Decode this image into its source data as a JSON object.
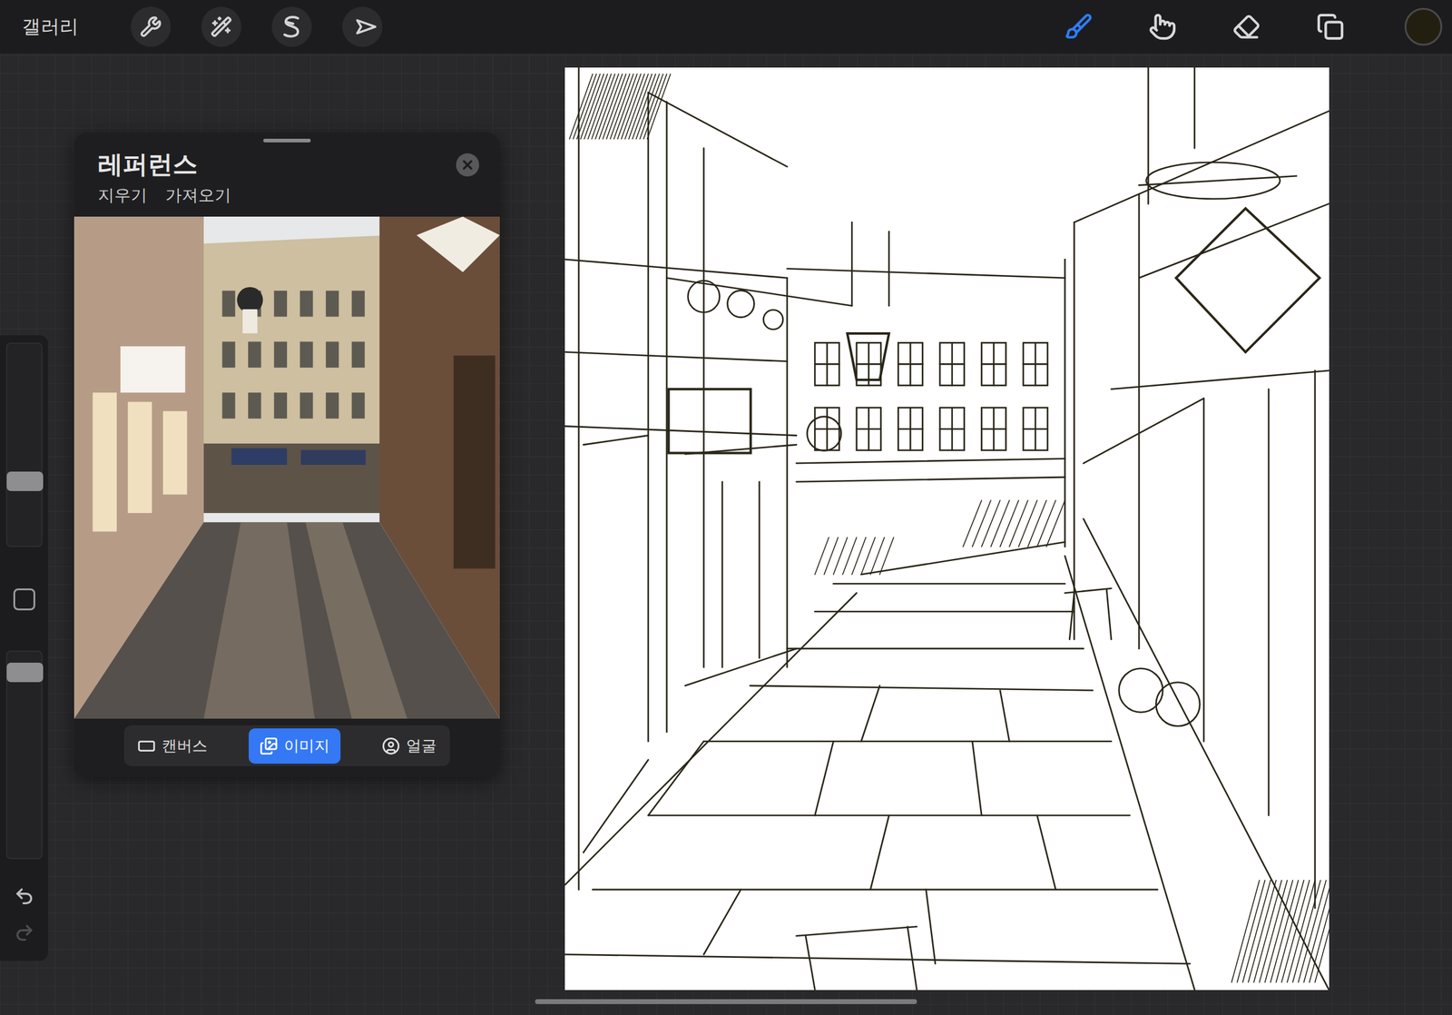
{
  "topbar": {
    "gallery": "갤러리",
    "tools_left": [
      {
        "kind": "wrench"
      },
      {
        "kind": "adjust"
      },
      {
        "kind": "selection"
      },
      {
        "kind": "transform"
      }
    ],
    "tools_right": [
      {
        "kind": "brush",
        "selected": true
      },
      {
        "kind": "smudge",
        "selected": false
      },
      {
        "kind": "eraser",
        "selected": false
      },
      {
        "kind": "layers",
        "selected": false
      }
    ],
    "current_color": "#231f10"
  },
  "sidebar": {
    "sliders": [
      {
        "name": "brush-size",
        "level": 0.3
      },
      {
        "name": "opacity",
        "level": 0.94
      }
    ],
    "undo": {
      "disabled": false
    },
    "redo": {
      "disabled": true
    }
  },
  "reference": {
    "title": "레퍼런스",
    "actions": [
      "지우기",
      "가져오기"
    ],
    "tabs": [
      {
        "label": "캔버스",
        "selected": false
      },
      {
        "label": "이미지",
        "selected": true
      },
      {
        "label": "얼굴",
        "selected": false
      }
    ]
  }
}
